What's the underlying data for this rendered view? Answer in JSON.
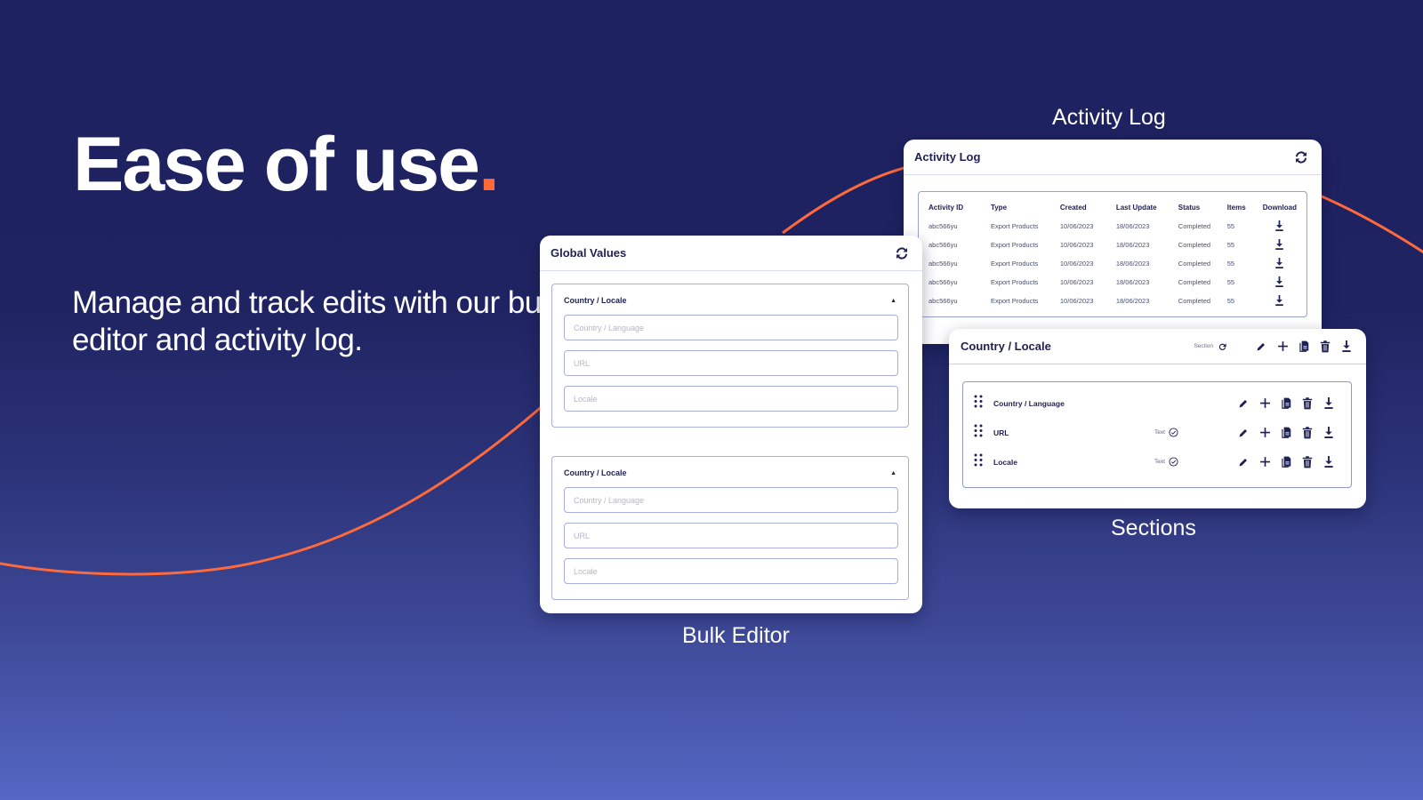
{
  "hero": {
    "title": "Ease of use",
    "title_dot": ".",
    "subtitle": "Manage and track edits with our bulk editor and activity log."
  },
  "captions": {
    "activity_log": "Activity Log",
    "bulk_editor": "Bulk Editor",
    "sections": "Sections"
  },
  "colors": {
    "accent": "#ff6a3d",
    "navy": "#1e2152",
    "bg_top": "#1e2160",
    "bg_bottom": "#5467c3"
  },
  "activity_log": {
    "title": "Activity Log",
    "refresh_icon": "refresh-icon",
    "columns": [
      "Activity ID",
      "Type",
      "Created",
      "Last Update",
      "Status",
      "Items",
      "Download"
    ],
    "rows": [
      {
        "id": "abc566yu",
        "type": "Export Products",
        "created": "10/06/2023",
        "updated": "18/06/2023",
        "status": "Completed",
        "items": "55"
      },
      {
        "id": "abc566yu",
        "type": "Export Products",
        "created": "10/06/2023",
        "updated": "18/06/2023",
        "status": "Completed",
        "items": "55"
      },
      {
        "id": "abc566yu",
        "type": "Export Products",
        "created": "10/06/2023",
        "updated": "18/06/2023",
        "status": "Completed",
        "items": "55"
      },
      {
        "id": "abc566yu",
        "type": "Export Products",
        "created": "10/06/2023",
        "updated": "18/06/2023",
        "status": "Completed",
        "items": "55"
      },
      {
        "id": "abc566yu",
        "type": "Export Products",
        "created": "10/06/2023",
        "updated": "18/06/2023",
        "status": "Completed",
        "items": "55"
      }
    ]
  },
  "global_values": {
    "title": "Global Values",
    "sections": [
      {
        "label": "Country / Locale",
        "fields": [
          {
            "placeholder": "Country / Language",
            "value": ""
          },
          {
            "placeholder": "URL",
            "value": ""
          },
          {
            "placeholder": "Locale",
            "value": ""
          }
        ]
      },
      {
        "label": "Country / Locale",
        "fields": [
          {
            "placeholder": "Country / Language",
            "value": ""
          },
          {
            "placeholder": "URL",
            "value": ""
          },
          {
            "placeholder": "Locale",
            "value": ""
          }
        ]
      }
    ]
  },
  "sections_panel": {
    "title": "Country / Locale",
    "tag": "Section",
    "fields": [
      {
        "name": "Country / Language",
        "type": ""
      },
      {
        "name": "URL",
        "type": "Text"
      },
      {
        "name": "Locale",
        "type": "Text"
      }
    ]
  }
}
